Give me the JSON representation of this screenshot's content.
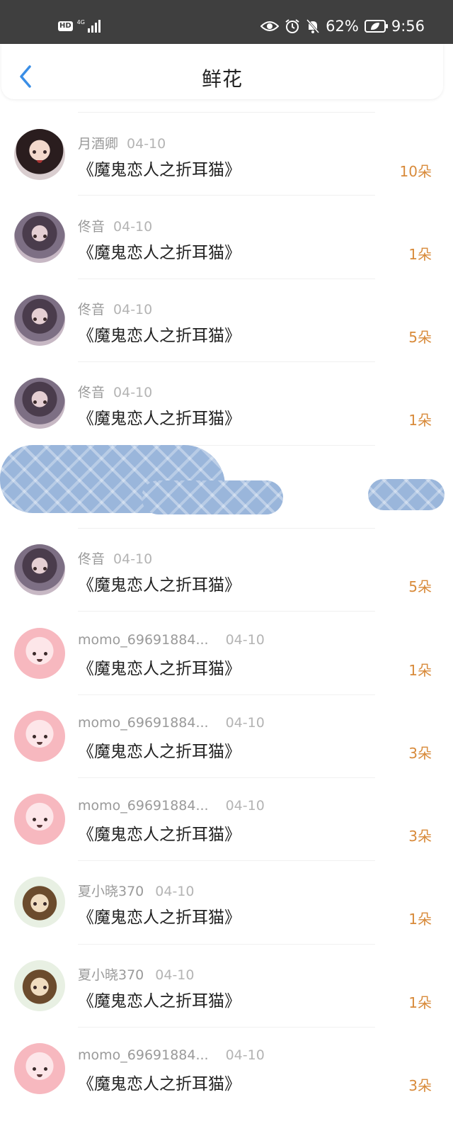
{
  "status_bar": {
    "hd": "HD",
    "network": "4G",
    "battery_percent": "62%",
    "time": "9:56",
    "icons": [
      "eye-icon",
      "alarm-icon",
      "bell-mute-icon",
      "battery-icon"
    ]
  },
  "header": {
    "title": "鲜花",
    "back_icon": "chevron-left-icon"
  },
  "colors": {
    "count": "#d88a3a",
    "accent": "#3a8ee6",
    "redaction": "#9ab6db"
  },
  "rows": [
    {
      "name": "月酒卿",
      "date": "04-10",
      "book": "《魔鬼恋人之折耳猫》",
      "count": "10朵",
      "avatar": "woman"
    },
    {
      "name": "佟音",
      "date": "04-10",
      "book": "《魔鬼恋人之折耳猫》",
      "count": "1朵",
      "avatar": "girl"
    },
    {
      "name": "佟音",
      "date": "04-10",
      "book": "《魔鬼恋人之折耳猫》",
      "count": "5朵",
      "avatar": "girl"
    },
    {
      "name": "佟音",
      "date": "04-10",
      "book": "《魔鬼恋人之折耳猫》",
      "count": "1朵",
      "avatar": "girl"
    },
    {
      "name": "佟音",
      "date": "04-10",
      "book": "《魔鬼恋人之折耳猫》",
      "count": "5朵",
      "avatar": "girl"
    },
    {
      "name": "momo_69691884...",
      "date": "04-10",
      "book": "《魔鬼恋人之折耳猫》",
      "count": "1朵",
      "avatar": "momo"
    },
    {
      "name": "momo_69691884...",
      "date": "04-10",
      "book": "《魔鬼恋人之折耳猫》",
      "count": "3朵",
      "avatar": "momo"
    },
    {
      "name": "momo_69691884...",
      "date": "04-10",
      "book": "《魔鬼恋人之折耳猫》",
      "count": "3朵",
      "avatar": "momo"
    },
    {
      "name": "夏小晓370",
      "date": "04-10",
      "book": "《魔鬼恋人之折耳猫》",
      "count": "1朵",
      "avatar": "boy"
    },
    {
      "name": "夏小晓370",
      "date": "04-10",
      "book": "《魔鬼恋人之折耳猫》",
      "count": "1朵",
      "avatar": "boy"
    },
    {
      "name": "momo_69691884...",
      "date": "04-10",
      "book": "《魔鬼恋人之折耳猫》",
      "count": "3朵",
      "avatar": "momo"
    }
  ]
}
